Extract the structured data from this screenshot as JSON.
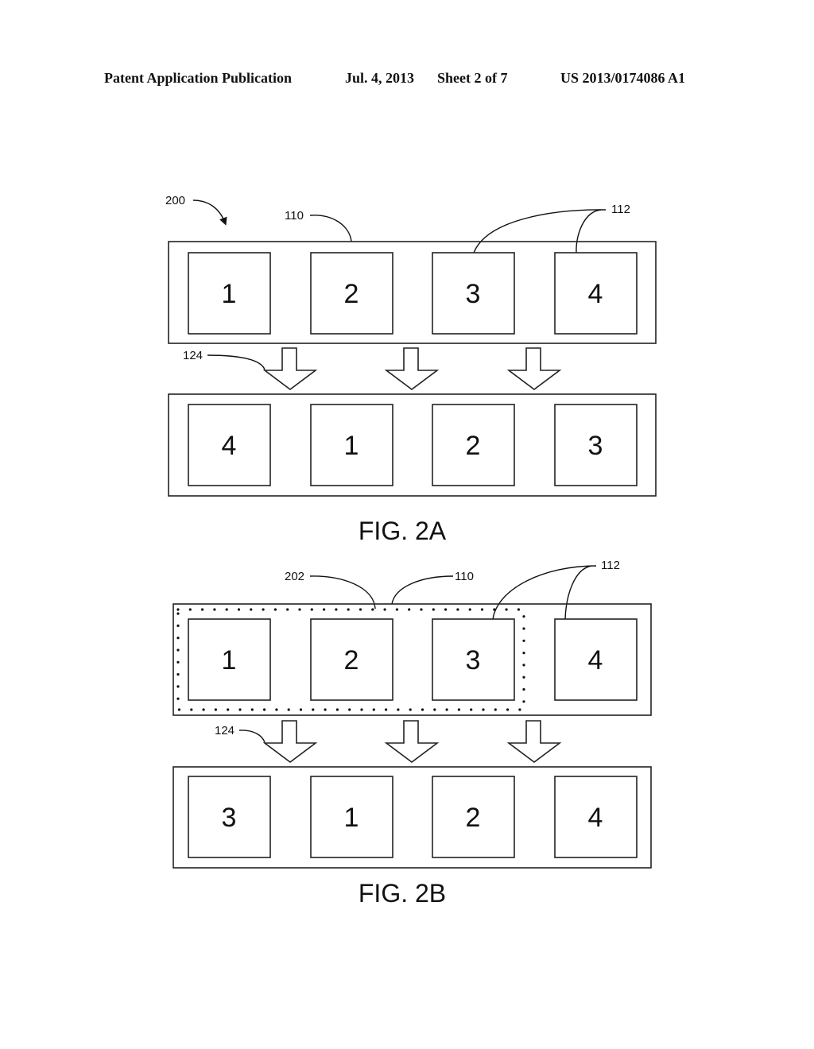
{
  "header": {
    "publication": "Patent Application Publication",
    "date": "Jul. 4, 2013",
    "sheet": "Sheet 2 of 7",
    "patent_number": "US 2013/0174086 A1"
  },
  "fig2a": {
    "caption": "FIG. 2A",
    "refs": {
      "system": "200",
      "container": "110",
      "items": "112",
      "transition": "124"
    },
    "top_row": [
      "1",
      "2",
      "3",
      "4"
    ],
    "bottom_row": [
      "4",
      "1",
      "2",
      "3"
    ]
  },
  "fig2b": {
    "caption": "FIG. 2B",
    "refs": {
      "selection": "202",
      "container": "110",
      "items": "112",
      "transition": "124"
    },
    "top_row": [
      "1",
      "2",
      "3",
      "4"
    ],
    "bottom_row": [
      "3",
      "1",
      "2",
      "4"
    ]
  }
}
